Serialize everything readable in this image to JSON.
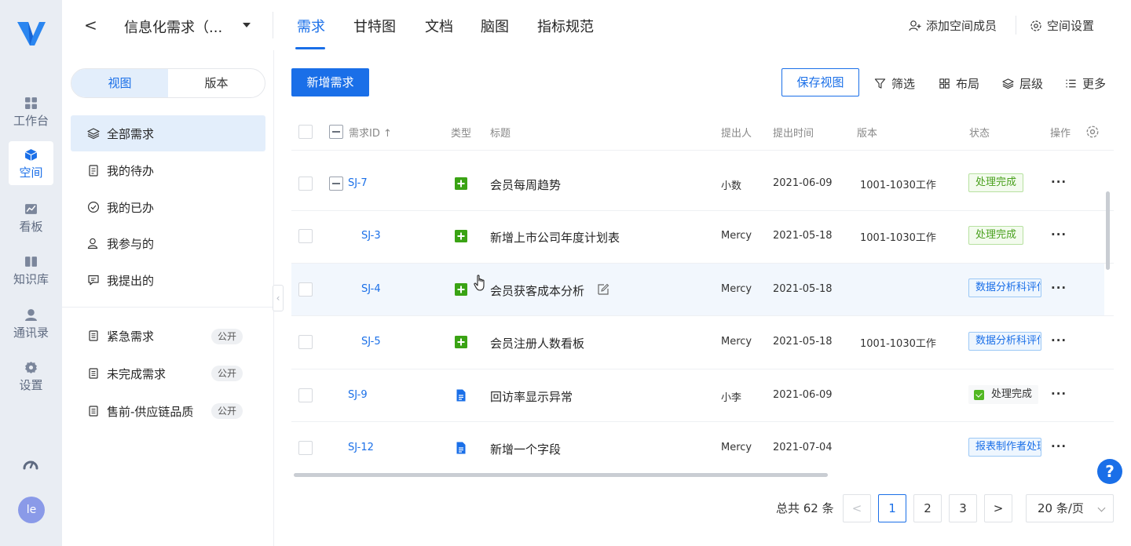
{
  "rail": {
    "items": [
      {
        "label": "工作台",
        "icon": "dashboard-icon"
      },
      {
        "label": "空间",
        "icon": "cube-icon",
        "active": true
      },
      {
        "label": "看板",
        "icon": "chart-icon"
      },
      {
        "label": "知识库",
        "icon": "book-icon"
      },
      {
        "label": "通讯录",
        "icon": "user-icon"
      },
      {
        "label": "设置",
        "icon": "gear-icon"
      }
    ],
    "avatar": "le"
  },
  "topbar": {
    "back": "<",
    "space_title": "信息化需求（...",
    "tabs": [
      "需求",
      "甘特图",
      "文档",
      "脑图",
      "指标规范"
    ],
    "add_member": "添加空间成员",
    "space_settings": "空间设置"
  },
  "side": {
    "segments": [
      "视图",
      "版本"
    ],
    "views": [
      "全部需求",
      "我的待办",
      "我的已办",
      "我参与的",
      "我提出的"
    ],
    "custom_views": [
      {
        "label": "紧急需求",
        "tag": "公开"
      },
      {
        "label": "未完成需求",
        "tag": "公开"
      },
      {
        "label": "售前-供应链品质",
        "tag": "公开"
      }
    ]
  },
  "toolbar": {
    "add": "新增需求",
    "save_view": "保存视图",
    "filter": "筛选",
    "layout": "布局",
    "level": "层级",
    "more": "更多"
  },
  "table": {
    "headers": {
      "id": "需求ID",
      "sort": "↑",
      "type": "类型",
      "title": "标题",
      "proposer": "提出人",
      "time": "提出时间",
      "version": "版本",
      "status": "状态",
      "action": "操作"
    },
    "rows": [
      {
        "id": "SJ-7",
        "type": "story",
        "title": "会员每周趋势",
        "proposer": "小数",
        "time": "2021-06-09",
        "version": "1001-1030工作",
        "status": "处理完成",
        "status_style": "green"
      },
      {
        "id": "SJ-3",
        "type": "story",
        "title": "新增上市公司年度计划表",
        "proposer": "Mercy",
        "time": "2021-05-18",
        "version": "1001-1030工作",
        "status": "处理完成",
        "status_style": "green"
      },
      {
        "id": "SJ-4",
        "type": "story",
        "title": "会员获客成本分析",
        "proposer": "Mercy",
        "time": "2021-05-18",
        "version": "",
        "status": "数据分析科评估",
        "status_style": "blue"
      },
      {
        "id": "SJ-5",
        "type": "story",
        "title": "会员注册人数看板",
        "proposer": "Mercy",
        "time": "2021-05-18",
        "version": "1001-1030工作",
        "status": "数据分析科评估",
        "status_style": "blue"
      },
      {
        "id": "SJ-9",
        "type": "doc",
        "title": "回访率显示异常",
        "proposer": "小李",
        "time": "2021-06-09",
        "version": "",
        "status": "处理完成",
        "status_style": "plain"
      },
      {
        "id": "SJ-12",
        "type": "doc",
        "title": "新增一个字段",
        "proposer": "Mercy",
        "time": "2021-07-04",
        "version": "",
        "status": "报表制作者处理",
        "status_style": "blue"
      }
    ],
    "more": "···"
  },
  "pagination": {
    "total": "总共 62 条",
    "pages": [
      "1",
      "2",
      "3"
    ],
    "prev": "<",
    "next": ">",
    "page_size": "20 条/页"
  },
  "help": "?",
  "colors": {
    "accent": "#1a6fe8",
    "story": "#3aa314",
    "doc": "#1a6fe8"
  }
}
